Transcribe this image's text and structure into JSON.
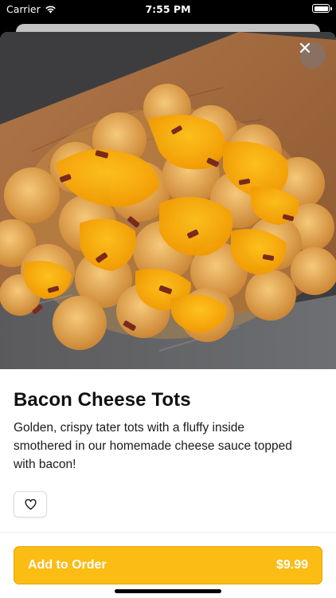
{
  "status_bar": {
    "carrier": "Carrier",
    "time": "7:55 PM",
    "wifi_icon": "wifi-icon",
    "battery_icon": "battery-icon"
  },
  "item": {
    "image_alt": "tater tots with cheese sauce and bacon on a wooden board",
    "name": "Bacon Cheese Tots",
    "description": "Golden, crispy tater tots with a fluffy inside smothered in our homemade cheese sauce topped with bacon!"
  },
  "actions": {
    "close_icon": "close-icon",
    "favorite_icon": "heart-icon",
    "add_label": "Add to Order",
    "price": "$9.99"
  },
  "colors": {
    "accent": "#fbbc14",
    "accent_border": "#e0a500",
    "text": "#111111"
  }
}
